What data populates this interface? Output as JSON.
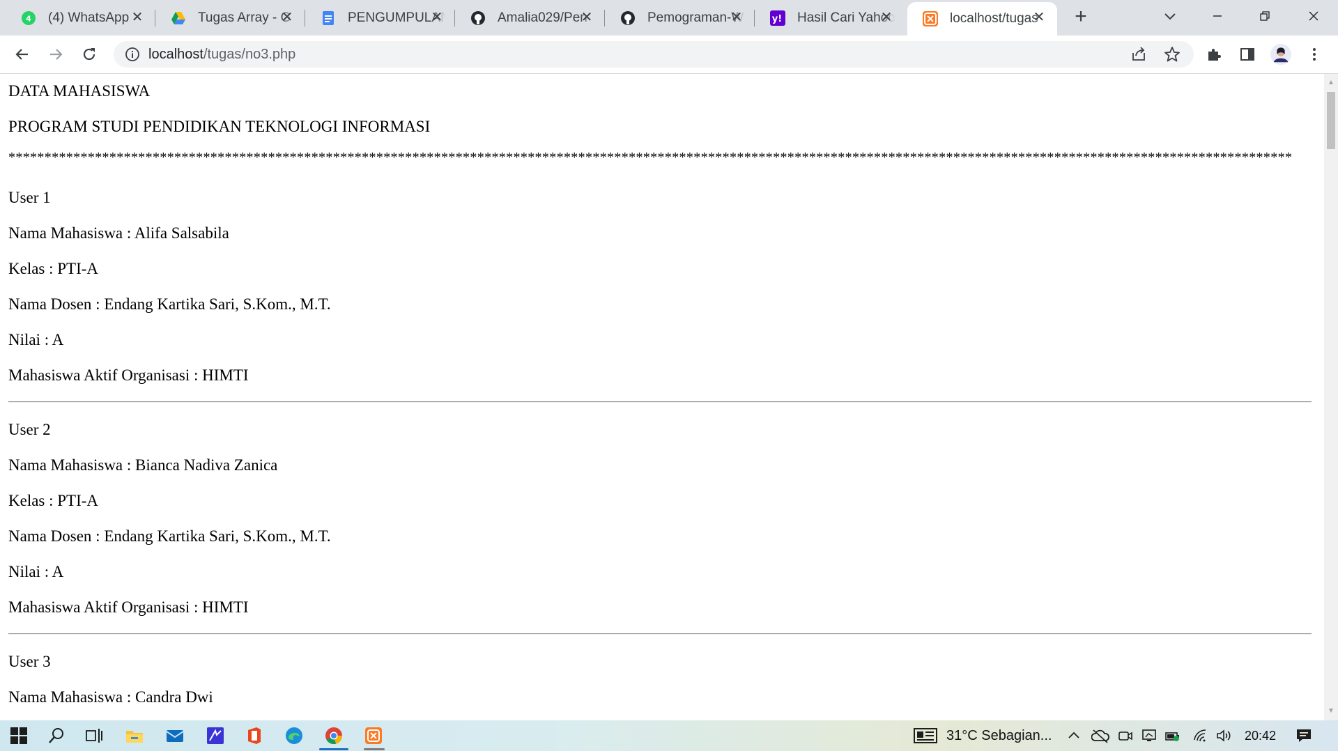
{
  "browser": {
    "tabs": [
      {
        "title": "(4) WhatsApp",
        "icon": "whatsapp-icon"
      },
      {
        "title": "Tugas Array - G",
        "icon": "google-drive-icon"
      },
      {
        "title": "PENGUMPULAN",
        "icon": "google-docs-icon"
      },
      {
        "title": "Amalia029/Pen",
        "icon": "github-icon"
      },
      {
        "title": "Pemograman-W",
        "icon": "github-icon"
      },
      {
        "title": "Hasil Cari Yahoo",
        "icon": "yahoo-icon"
      },
      {
        "title": "localhost/tugas",
        "icon": "xampp-icon",
        "active": true
      }
    ],
    "address": {
      "host": "localhost",
      "path": "/tugas/no3.php"
    }
  },
  "page": {
    "heading1": "DATA MAHASISWA",
    "heading2": "PROGRAM STUDI PENDIDIKAN TEKNOLOGI INFORMASI",
    "stars": "**********************************************************************************************************************************************************************************",
    "users": [
      {
        "label": "User 1",
        "nama": "Nama Mahasiswa : Alifa Salsabila",
        "kelas": "Kelas : PTI-A",
        "dosen": "Nama Dosen : Endang Kartika Sari, S.Kom., M.T.",
        "nilai": "Nilai : A",
        "organisasi": "Mahasiswa Aktif Organisasi : HIMTI"
      },
      {
        "label": "User 2",
        "nama": "Nama Mahasiswa : Bianca Nadiva Zanica",
        "kelas": "Kelas : PTI-A",
        "dosen": "Nama Dosen : Endang Kartika Sari, S.Kom., M.T.",
        "nilai": "Nilai : A",
        "organisasi": "Mahasiswa Aktif Organisasi : HIMTI"
      },
      {
        "label": "User 3",
        "nama": "Nama Mahasiswa : Candra Dwi"
      }
    ]
  },
  "taskbar": {
    "weather": "31°C  Sebagian...",
    "time": "20:42"
  },
  "colors": {
    "tabstrip": "#dee1e6",
    "omnibox": "#f1f3f4",
    "taskbar_accent": "#1a6fbf"
  }
}
